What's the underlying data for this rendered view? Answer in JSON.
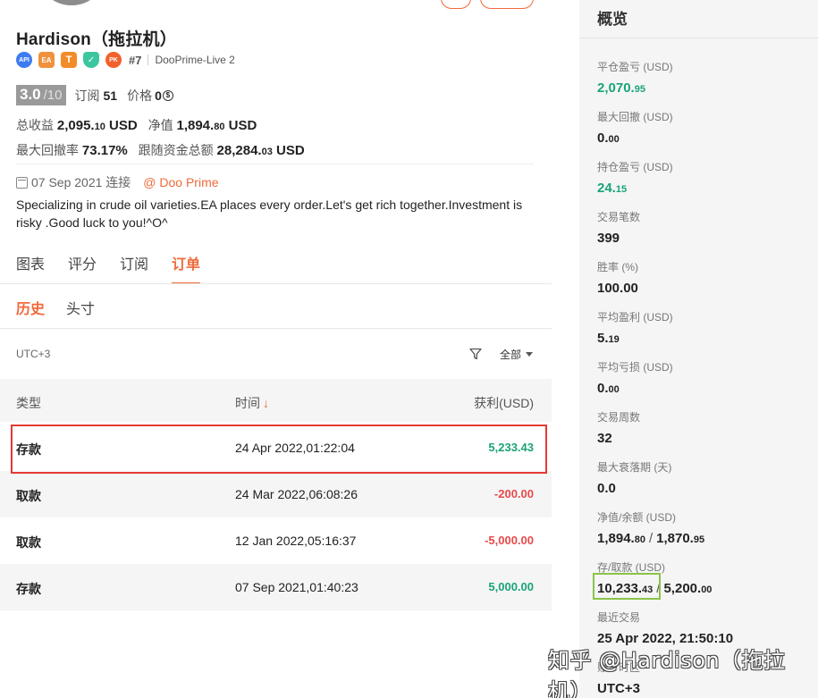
{
  "profile": {
    "name": "Hardison（拖拉机）",
    "badges": [
      {
        "icon": "api-badge-icon",
        "text": "API",
        "color": "#3d7bf0"
      },
      {
        "icon": "ea-badge-icon",
        "text": "EA",
        "color": "#f0913b"
      },
      {
        "icon": "t-badge-icon",
        "text": "T",
        "color": "#f28c28"
      },
      {
        "icon": "shield-badge-icon",
        "text": "✓",
        "color": "#3cc6a0"
      },
      {
        "icon": "pk-badge-icon",
        "text": "PK",
        "color": "#f2612b"
      }
    ],
    "rank": "#7",
    "server": "DooPrime-Live 2",
    "score": "3.0",
    "score_den": "/10",
    "subscribe_label": "订阅",
    "subscribe_count": "51",
    "price_label": "价格",
    "price_value": "0",
    "total_income_label": "总收益",
    "total_income_int": "2,095.",
    "total_income_dec": "10",
    "total_income_unit": " USD",
    "equity_label": "净值",
    "equity_int": "1,894.",
    "equity_dec": "80",
    "equity_unit": " USD",
    "max_drawdown_rate_label": "最大回撤率",
    "max_drawdown_rate": "73.17%",
    "follow_funds_label": "跟随资金总额",
    "follow_funds_int": "28,284.",
    "follow_funds_dec": "03",
    "follow_funds_unit": " USD",
    "connected": "07 Sep 2021 连接",
    "broker": "@ Doo Prime",
    "description": "Specializing in crude oil varieties.EA places every order.Let's get rich together.Investment is risky .Good luck to you!^O^"
  },
  "tabs": [
    "图表",
    "评分",
    "订阅",
    "订单"
  ],
  "active_tab": "订单",
  "subtabs": [
    "历史",
    "头寸"
  ],
  "timezone": "UTC+3",
  "filter_label": "全部",
  "table": {
    "headers": {
      "type": "类型",
      "time": "时间",
      "time_sort": "↓",
      "profit": "获利(USD)"
    },
    "rows": [
      {
        "type": "存款",
        "time": "24 Apr 2022,01:22:04",
        "profit": "5,233.43",
        "sign": "pos"
      },
      {
        "type": "取款",
        "time": "24 Mar 2022,06:08:26",
        "profit": "-200.00",
        "sign": "neg"
      },
      {
        "type": "取款",
        "time": "12 Jan 2022,05:16:37",
        "profit": "-5,000.00",
        "sign": "neg"
      },
      {
        "type": "存款",
        "time": "07 Sep 2021,01:40:23",
        "profit": "5,000.00",
        "sign": "pos"
      }
    ]
  },
  "overview": {
    "title": "概览",
    "closed_pl_label": "平仓盈亏 (USD)",
    "closed_pl_int": "2,070.",
    "closed_pl_dec": "95",
    "max_dd_label": "最大回撤 (USD)",
    "max_dd_int": "0.",
    "max_dd_dec": "00",
    "open_pl_label": "持仓盈亏 (USD)",
    "open_pl_int": "24.",
    "open_pl_dec": "15",
    "trades_label": "交易笔数",
    "trades": "399",
    "winrate_label": "胜率 (%)",
    "winrate": "100.00",
    "avg_win_label": "平均盈利 (USD)",
    "avg_win_int": "5.",
    "avg_win_dec": "19",
    "avg_loss_label": "平均亏损 (USD)",
    "avg_loss_int": "0.",
    "avg_loss_dec": "00",
    "weeks_label": "交易周数",
    "weeks": "32",
    "max_decline_label": "最大衰落期 (天)",
    "max_decline": "0.0",
    "equity_balance_label": "净值/余额 (USD)",
    "equity_int": "1,894.",
    "equity_dec": "80",
    "balance_int": "1,870.",
    "balance_dec": "95",
    "deposit_withdraw_label": "存/取款 (USD)",
    "deposit_int": "10,233.",
    "deposit_dec": "43",
    "withdraw_int": "5,200.",
    "withdraw_dec": "00",
    "slash": "/",
    "last_trade_label": "最近交易",
    "last_trade": "25 Apr 2022, 21:50:10",
    "account_tz_label": "账户时区",
    "account_tz": "UTC+3"
  },
  "watermark": "知乎 @Hardison（拖拉机）",
  "colors": {
    "accent": "#f06a3b",
    "positive": "#1aa37a",
    "negative": "#e84a4a"
  }
}
